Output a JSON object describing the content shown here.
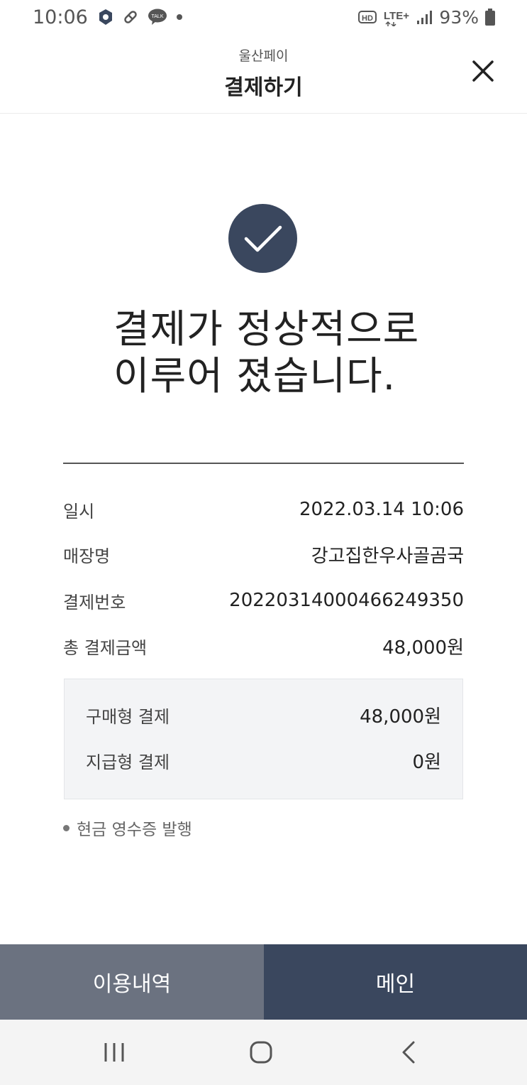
{
  "status_bar": {
    "time": "10:06",
    "battery_text": "93%",
    "icons": [
      "shield-icon",
      "pill-icon",
      "kakaotalk-icon",
      "dot-icon",
      "hd-icon",
      "lte-icon",
      "signal-icon",
      "battery-icon"
    ],
    "lte_label": "LTE+",
    "hd_label": "HD",
    "talk_label": "TALK"
  },
  "header": {
    "subtitle": "울산페이",
    "title": "결제하기"
  },
  "success": {
    "line1": "결제가 정상적으로",
    "line2": "이루어 졌습니다."
  },
  "details": [
    {
      "label": "일시",
      "value": "2022.03.14 10:06"
    },
    {
      "label": "매장명",
      "value": "강고집한우사골곰국"
    },
    {
      "label": "결제번호",
      "value": "20220314000466249350"
    },
    {
      "label": "총 결제금액",
      "value": "48,000원"
    }
  ],
  "breakdown": [
    {
      "label": "구매형 결제",
      "value": "48,000원"
    },
    {
      "label": "지급형 결제",
      "value": "0원"
    }
  ],
  "receipt_link": "현금 영수증 발행",
  "buttons": {
    "history": "이용내역",
    "main": "메인"
  },
  "colors": {
    "accent_dark": "#3a475e",
    "accent_gray": "#6b7280"
  }
}
